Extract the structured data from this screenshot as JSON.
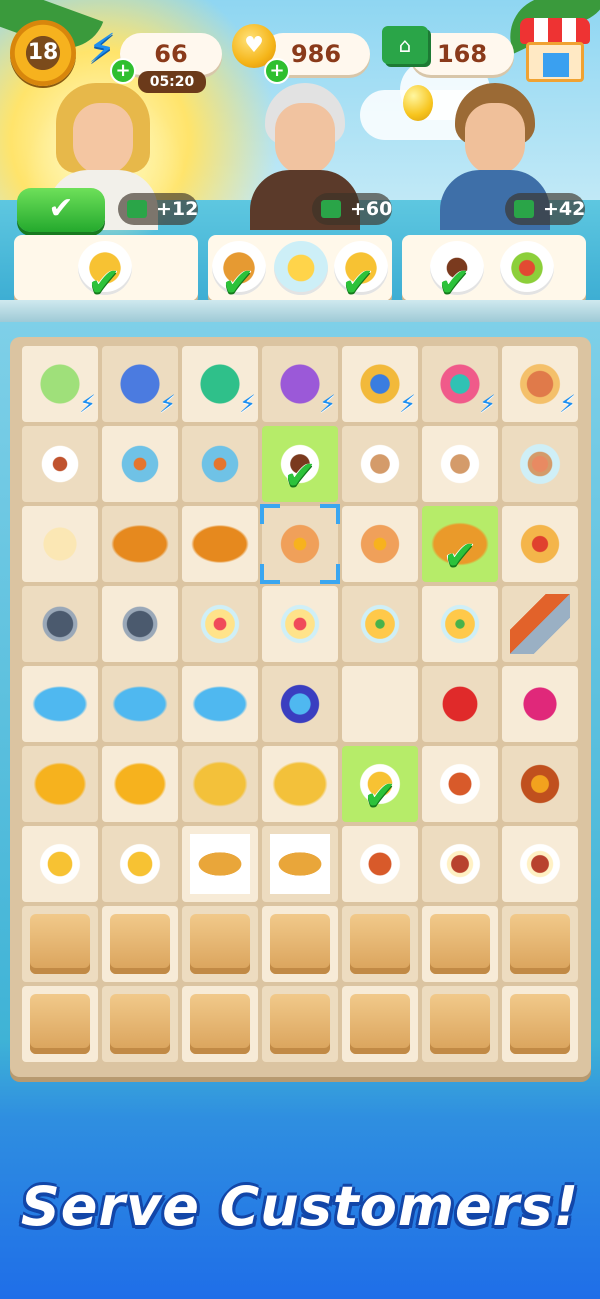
{
  "hud": {
    "level": "18",
    "energy": "66",
    "energy_timer": "05:20",
    "coins": "986",
    "cash": "168",
    "plus_glyph": "+"
  },
  "icons": [
    "level-star-icon",
    "lightning-energy-icon",
    "coin-icon",
    "cash-icon",
    "shop-icon",
    "checkmark-icon"
  ],
  "customers": [
    {
      "name_hint": "blonde-woman-customer",
      "reward": "+12",
      "served": true
    },
    {
      "name_hint": "old-man-customer",
      "reward": "+60",
      "served": false
    },
    {
      "name_hint": "young-man-customer",
      "reward": "+42",
      "served": false
    }
  ],
  "orders": [
    {
      "items": [
        "fries"
      ],
      "checks": [
        true
      ]
    },
    {
      "items": [
        "croissant",
        "lemonade",
        "fries"
      ],
      "checks": [
        true,
        false,
        true
      ]
    },
    {
      "items": [
        "coffee-cup",
        "fruit-plate"
      ],
      "checks": [
        true,
        false
      ]
    }
  ],
  "colors": {
    "accent_green": "#2cc23a",
    "banner_blue": "#1246a8",
    "highlight_cell": "#b6ec69",
    "selection_bracket": "#3aa6f0"
  },
  "board": {
    "rows": [
      [
        "toaster",
        "espresso-machine",
        "coffee-maker",
        "purple-vanity",
        "stand-stall",
        "market-stall",
        "bread-basket"
      ],
      [
        "paper-cup",
        "cup-to-go",
        "cup-to-go",
        "coffee-cup",
        "latte-cup",
        "latte-cup",
        "latte-heart"
      ],
      [
        "dough-ball",
        "bread-loaf",
        "bread-loaf",
        "egg-toast",
        "egg-toast",
        "croissant",
        "sandwich"
      ],
      [
        "frying-pan",
        "frying-pan",
        "fruit-cup",
        "fruit-cup",
        "lemonade",
        "lemonade",
        "spatula"
      ],
      [
        "blue-crystal",
        "blue-crystal",
        "blue-crystal",
        "crystal-chest",
        "",
        "tomato",
        "radish"
      ],
      [
        "coin-stack",
        "coin-stack",
        "coin-pile",
        "coin-pile",
        "fries-plate",
        "lasagna",
        "treasure-chest"
      ],
      [
        "fries-plate",
        "fries-plate",
        "taco-plate",
        "taco-plate",
        "lasagna",
        "bacon-breakfast",
        "bacon-breakfast"
      ],
      [
        "box",
        "box",
        "box",
        "box",
        "box",
        "box",
        "box"
      ],
      [
        "box",
        "box",
        "box",
        "box",
        "box",
        "box",
        "box"
      ]
    ],
    "highlighted_cells": [
      [
        1,
        3
      ],
      [
        2,
        5
      ],
      [
        5,
        4
      ]
    ],
    "selected_cell": [
      2,
      3
    ],
    "energy_generators": [
      0,
      1,
      2,
      3,
      4,
      5,
      6
    ]
  },
  "banner_text": "Serve Customers!"
}
